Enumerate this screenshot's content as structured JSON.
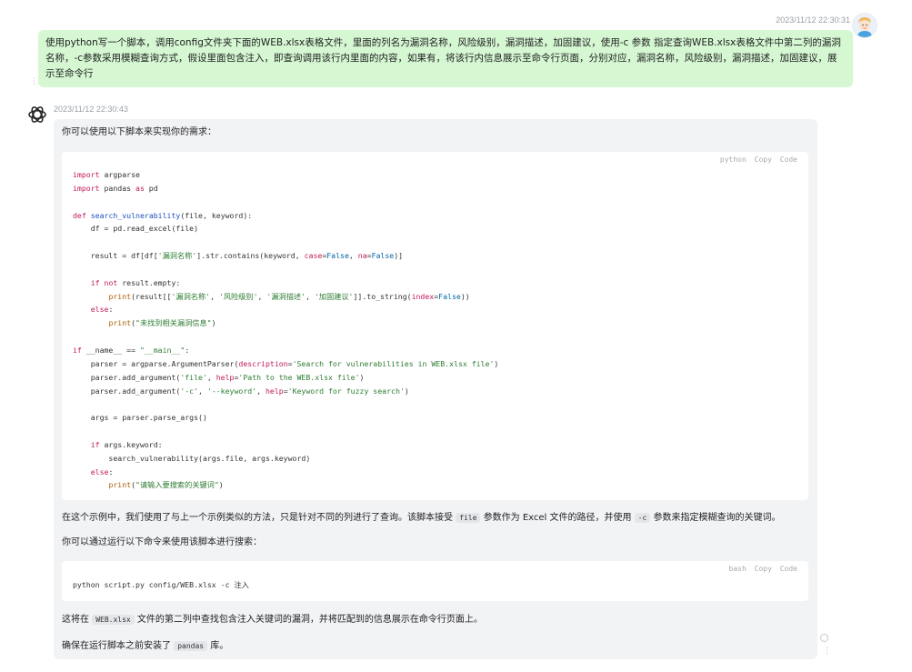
{
  "user_message": {
    "timestamp": "2023/11/12 22:30:31",
    "text": "使用python写一个脚本，调用config文件夹下面的WEB.xlsx表格文件，里面的列名为漏洞名称，风险级别，漏洞描述，加固建议，使用-c 参数 指定查询WEB.xlsx表格文件中第二列的漏洞名称，-c参数采用模糊查询方式，假设里面包含注入，即查询调用该行内里面的内容，如果有，将该行内信息展示至命令行页面，分别对应，漏洞名称，风险级别，漏洞描述，加固建议，展示至命令行"
  },
  "assistant_message": {
    "timestamp": "2023/11/12 22:30:43",
    "intro": "你可以使用以下脚本来实现你的需求：",
    "code_block_1": {
      "language": "python",
      "copy_label": "Copy",
      "code_label": "Code",
      "lines": [
        "import argparse",
        "import pandas as pd",
        "",
        "def search_vulnerability(file, keyword):",
        "    df = pd.read_excel(file)",
        "",
        "    result = df[df['漏洞名称'].str.contains(keyword, case=False, na=False)]",
        "",
        "    if not result.empty:",
        "        print(result[['漏洞名称', '风险级别', '漏洞描述', '加固建议']].to_string(index=False))",
        "    else:",
        "        print(\"未找到相关漏洞信息\")",
        "",
        "if __name__ == \"__main__\":",
        "    parser = argparse.ArgumentParser(description='Search for vulnerabilities in WEB.xlsx file')",
        "    parser.add_argument('file', help='Path to the WEB.xlsx file')",
        "    parser.add_argument('-c', '--keyword', help='Keyword for fuzzy search')",
        "",
        "    args = parser.parse_args()",
        "",
        "    if args.keyword:",
        "        search_vulnerability(args.file, args.keyword)",
        "    else:",
        "        print(\"请输入要搜索的关键词\")"
      ]
    },
    "para1": {
      "a": "在这个示例中，我们使用了与上一个示例类似的方法，只是针对不同的列进行了查询。该脚本接受",
      "code1": "file",
      "b": "参数作为 Excel 文件的路径，并使用",
      "code2": "-c",
      "c": "参数来指定模糊查询的关键词。"
    },
    "para2": "你可以通过运行以下命令来使用该脚本进行搜索：",
    "code_block_2": {
      "language": "bash",
      "copy_label": "Copy",
      "code_label": "Code",
      "command": "python script.py config/WEB.xlsx -c 注入"
    },
    "para3": {
      "a": "这将在",
      "code1": "WEB.xlsx",
      "b": "文件的第二列中查找包含注入关键词的漏洞，并将匹配到的信息展示在命令行页面上。"
    },
    "para4": {
      "a": "确保在运行脚本之前安装了",
      "code1": "pandas",
      "b": "库。"
    }
  }
}
